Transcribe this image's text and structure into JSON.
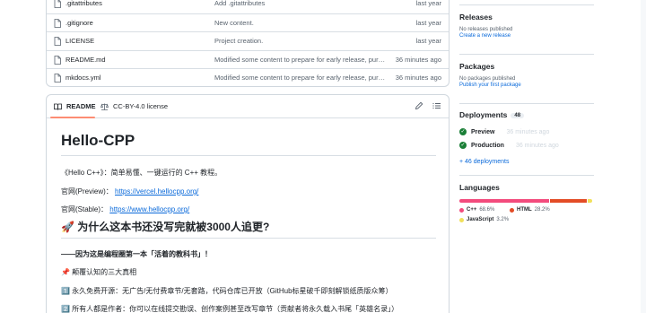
{
  "files": [
    {
      "name": ".gitattributes",
      "message": "Add .gitattributes",
      "time": "last year"
    },
    {
      "name": ".gitignore",
      "message": "New content.",
      "time": "last year"
    },
    {
      "name": "LICENSE",
      "message": "Project creation.",
      "time": "last year"
    },
    {
      "name": "README.md",
      "message": "Modified some content to prepare for early release, purch...",
      "time": "36 minutes ago"
    },
    {
      "name": "mkdocs.yml",
      "message": "Modified some content to prepare for early release, purch...",
      "time": "36 minutes ago"
    }
  ],
  "readme": {
    "tab_label": "README",
    "license_label": "CC-BY-4.0 license",
    "title": "Hello-CPP",
    "intro": "《Hello C++》：简单易懂、一键运行的 C++ 教程。",
    "preview_label": "官网(Preview)：",
    "preview_url": "https://vercel.hellocpp.org/",
    "stable_label": "官网(Stable)：",
    "stable_url": "https://www.hellocpp.org/",
    "h2": "🚀 为什么这本书还没写完就被3000人追更?",
    "reason_title": "——因为这是编程圈第一本「活着的教科书」！",
    "subsection": "📌 颠覆认知的三大真相",
    "point1": "1️⃣ 永久免费开源：无广告/无付费章节/无套路，代码仓库已开放（GitHub标星破千即刻解锁纸质版众筹）",
    "point2": "2️⃣ 所有人都是作者：你可以在线提交勘误、创作案例甚至改写章节（贡献者将永久载入书尾「英雄名录」）"
  },
  "sidebar": {
    "releases_title": "Releases",
    "releases_none": "No releases published",
    "releases_link": "Create a new release",
    "packages_title": "Packages",
    "packages_none": "No packages published",
    "packages_link": "Publish your first package",
    "deployments_title": "Deployments",
    "deployments_count": "48",
    "deployments": [
      {
        "name": "Preview",
        "time": "36 minutes ago"
      },
      {
        "name": "Production",
        "time": "36 minutes ago"
      }
    ],
    "more_deployments": "+ 46 deployments",
    "languages_title": "Languages",
    "languages": [
      {
        "name": "C++",
        "percent": "68.6%",
        "value": 68.6,
        "color": "#f34b7d"
      },
      {
        "name": "HTML",
        "percent": "28.2%",
        "value": 28.2,
        "color": "#e34c26"
      },
      {
        "name": "JavaScript",
        "percent": "3.2%",
        "value": 3.2,
        "color": "#f1e05a"
      }
    ]
  }
}
